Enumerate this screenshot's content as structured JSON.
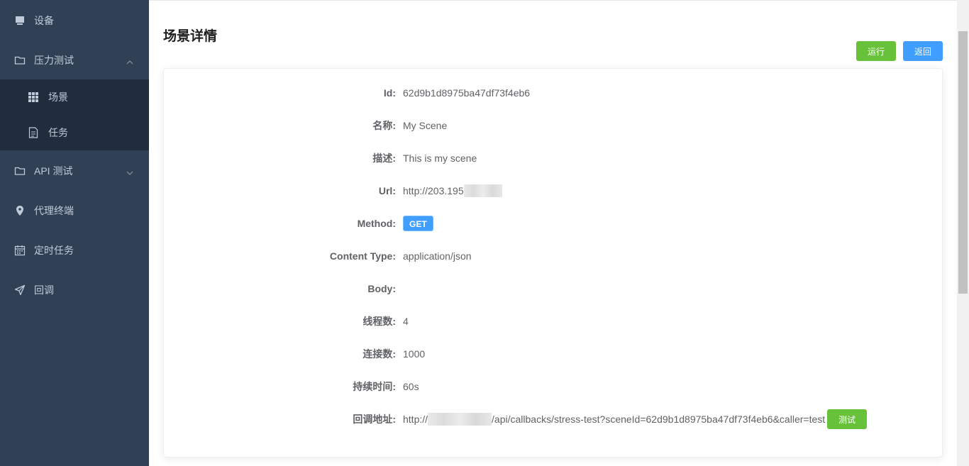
{
  "sidebar": {
    "items": [
      {
        "label": "设备",
        "icon": "monitor-icon"
      },
      {
        "label": "压力测试",
        "icon": "folder-icon"
      },
      {
        "label": "API 测试",
        "icon": "folder-icon"
      },
      {
        "label": "代理终端",
        "icon": "location-icon"
      },
      {
        "label": "定时任务",
        "icon": "calendar-icon"
      },
      {
        "label": "回调",
        "icon": "send-icon"
      }
    ],
    "sub_items": [
      {
        "label": "场景",
        "icon": "grid-icon"
      },
      {
        "label": "任务",
        "icon": "document-icon"
      }
    ]
  },
  "page": {
    "title": "场景详情",
    "run_label": "运行",
    "back_label": "返回"
  },
  "details": {
    "id_label": "Id:",
    "id_value": "62d9b1d8975ba47df73f4eb6",
    "name_label": "名称:",
    "name_value": "My Scene",
    "desc_label": "描述:",
    "desc_value": "This is my scene",
    "url_label": "Url:",
    "url_value": "http://203.195",
    "method_label": "Method:",
    "method_value": "GET",
    "content_type_label": "Content Type:",
    "content_type_value": "application/json",
    "body_label": "Body:",
    "threads_label": "线程数:",
    "threads_value": "4",
    "connections_label": "连接数:",
    "connections_value": "1000",
    "duration_label": "持续时间:",
    "duration_value": "60s",
    "callback_label": "回调地址:",
    "callback_prefix": "http://",
    "callback_suffix": "/api/callbacks/stress-test?sceneId=62d9b1d8975ba47df73f4eb6&caller=test",
    "test_label": "测试"
  },
  "colors": {
    "sidebar_bg": "#304156",
    "submenu_bg": "#1f2d3d",
    "success": "#67c23a",
    "primary": "#409eff"
  }
}
